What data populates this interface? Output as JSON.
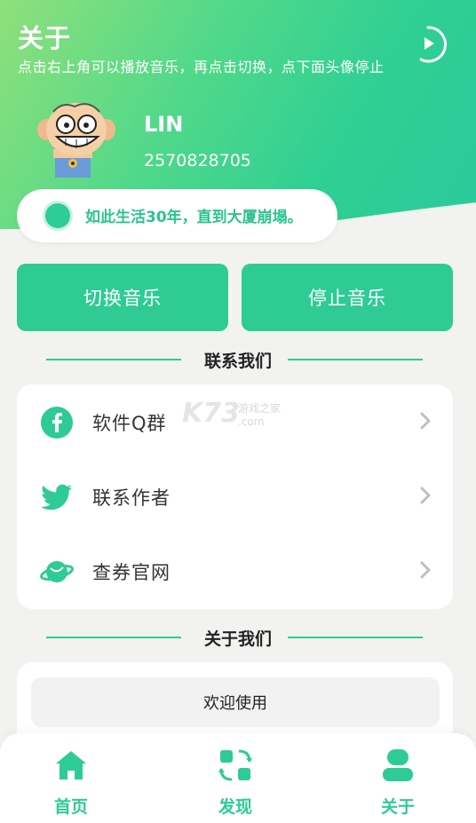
{
  "header": {
    "title": "关于",
    "subtitle": "点击右上角可以播放音乐，再点击切换，点下面头像停止",
    "play_icon": "play-circle-icon"
  },
  "profile": {
    "name": "LIN",
    "id": "2570828705",
    "avatar_icon": "cartoon-avatar"
  },
  "motto": {
    "text": "如此生活30年，直到大厦崩塌。"
  },
  "buttons": {
    "switch_music": "切换音乐",
    "stop_music": "停止音乐"
  },
  "contact": {
    "heading": "联系我们",
    "items": [
      {
        "label": "软件Q群",
        "icon": "facebook-icon"
      },
      {
        "label": "联系作者",
        "icon": "twitter-icon"
      },
      {
        "label": "查券官网",
        "icon": "planet-icon"
      }
    ]
  },
  "about": {
    "heading": "关于我们",
    "welcome": "欢迎使用"
  },
  "watermark": {
    "logo": "K73",
    "text": "游戏之家",
    "domain": ".com"
  },
  "nav": {
    "items": [
      {
        "label": "首页",
        "icon": "home-icon"
      },
      {
        "label": "发现",
        "icon": "discover-icon"
      },
      {
        "label": "关于",
        "icon": "user-icon"
      }
    ]
  },
  "colors": {
    "accent": "#2ecb95",
    "gradient_start": "#8fe07a",
    "gradient_end": "#2cc99b",
    "background": "#f2f3f1"
  }
}
